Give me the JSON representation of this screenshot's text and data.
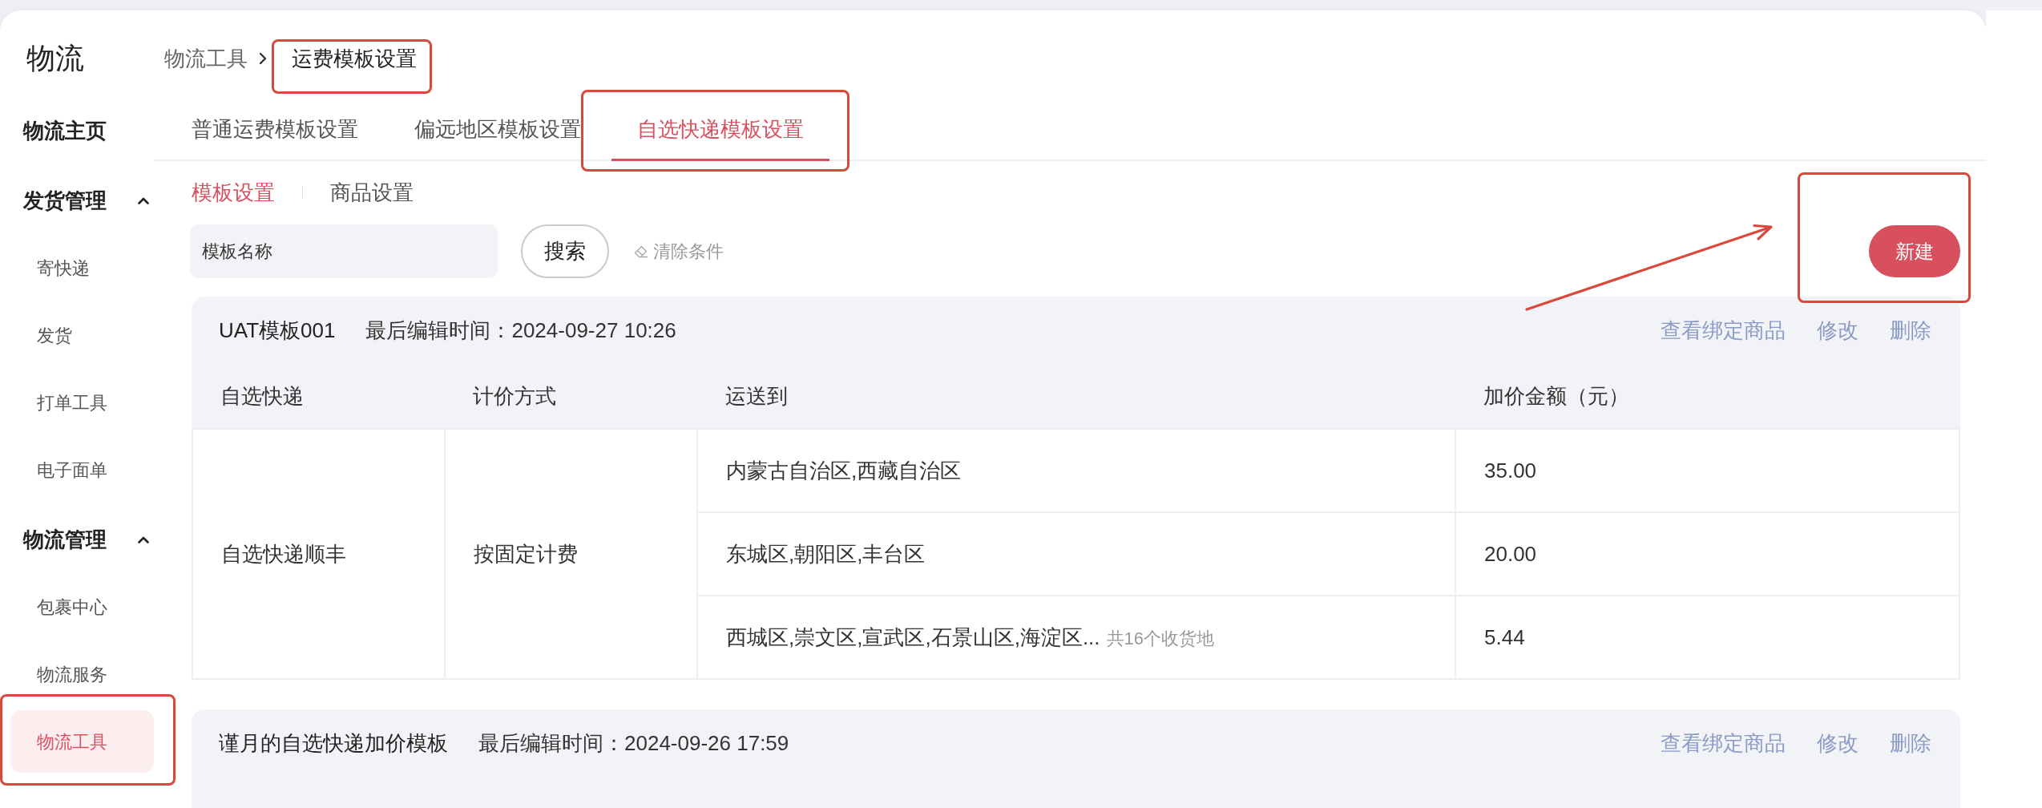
{
  "sidebar": {
    "title": "物流",
    "items": [
      {
        "kind": "page",
        "label": "物流主页",
        "selected": false,
        "highlighted": false
      },
      {
        "kind": "group",
        "label": "发货管理",
        "selected": false,
        "highlighted": false,
        "expanded": true,
        "children": [
          {
            "label": "寄快递",
            "selected": false,
            "highlighted": false
          },
          {
            "label": "发货",
            "selected": false,
            "highlighted": false
          },
          {
            "label": "打单工具",
            "selected": false,
            "highlighted": false
          },
          {
            "label": "电子面单",
            "selected": false,
            "highlighted": false
          }
        ]
      },
      {
        "kind": "group",
        "label": "物流管理",
        "selected": false,
        "highlighted": false,
        "expanded": true,
        "children": [
          {
            "label": "包裹中心",
            "selected": false,
            "highlighted": false
          },
          {
            "label": "物流服务",
            "selected": false,
            "highlighted": false
          },
          {
            "label": "物流工具",
            "selected": true,
            "highlighted": true
          }
        ]
      }
    ]
  },
  "breadcrumb": [
    {
      "label": "物流工具",
      "current": false,
      "highlighted": false
    },
    {
      "label": "运费模板设置",
      "current": true,
      "highlighted": true
    }
  ],
  "tabs": [
    {
      "label": "普通运费模板设置",
      "selected": false,
      "highlighted": false
    },
    {
      "label": "偏远地区模板设置",
      "selected": false,
      "highlighted": false
    },
    {
      "label": "自选快递模板设置",
      "selected": true,
      "highlighted": true
    }
  ],
  "subtabs": [
    {
      "label": "模板设置",
      "selected": true
    },
    {
      "label": "商品设置",
      "selected": false
    }
  ],
  "search": {
    "placeholder": "模板名称",
    "button": "搜索",
    "clear": "清除条件"
  },
  "new_button": {
    "label": "新建",
    "highlighted": true,
    "pointer_arrow": true
  },
  "templates": [
    {
      "name": "UAT模板001",
      "edited": "最后编辑时间：2024-09-27 10:26",
      "actions": [
        "查看绑定商品",
        "修改",
        "删除"
      ],
      "columns": [
        "自选快递",
        "计价方式",
        "运送到",
        "加价金额（元）"
      ],
      "rows": [
        {
          "express": "自选快递顺丰",
          "pricing": "按固定计费",
          "destinations": [
            {
              "areas": "内蒙古自治区,西藏自治区",
              "amount": "35.00"
            },
            {
              "areas": "东城区,朝阳区,丰台区",
              "amount": "20.00"
            },
            {
              "areas": "西城区,崇文区,宣武区,石景山区,海淀区...",
              "count_note": "共16个收货地",
              "amount": "5.44"
            }
          ]
        }
      ]
    },
    {
      "name": "谨月的自选快递加价模板",
      "edited": "最后编辑时间：2024-09-26 17:59",
      "actions": [
        "查看绑定商品",
        "修改",
        "删除"
      ]
    }
  ]
}
